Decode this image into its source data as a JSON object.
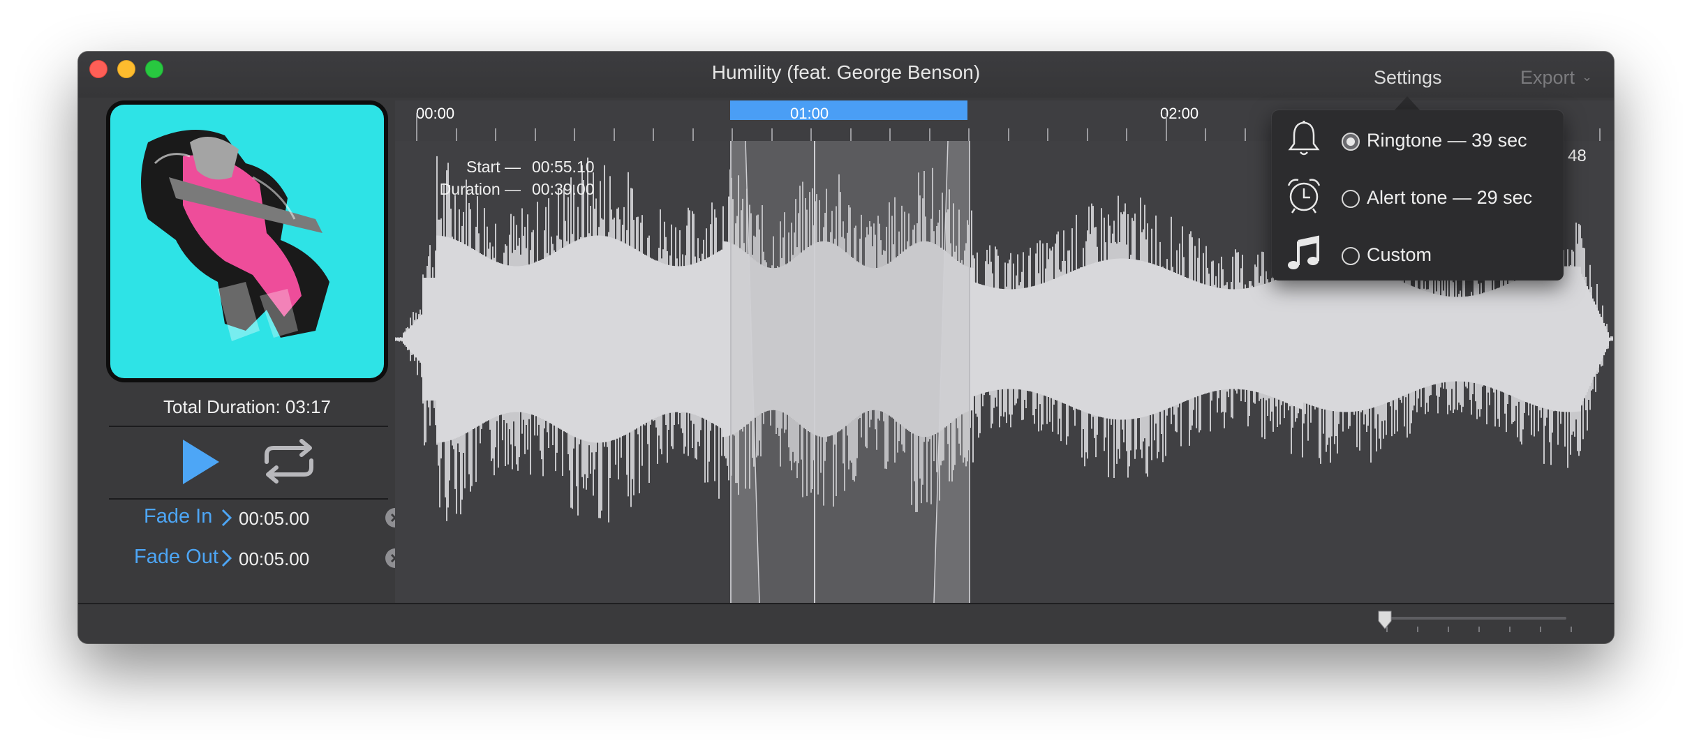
{
  "window": {
    "title": "Humility (feat. George Benson)",
    "settings_label": "Settings",
    "export_label": "Export"
  },
  "left_panel": {
    "total_duration": "Total Duration: 03:17",
    "fade_in": {
      "label": "Fade In",
      "value": "00:05.00"
    },
    "fade_out": {
      "label": "Fade Out",
      "value": "00:05.00"
    }
  },
  "timeline": {
    "ticks": [
      "00:00",
      "01:00",
      "02:00"
    ],
    "end_time_partial": "48",
    "selection": {
      "start_label": "Start —",
      "start_value": "00:55.10",
      "duration_label": "Duration —",
      "duration_value": "00:39.00"
    }
  },
  "settings_popover": {
    "options": [
      {
        "label": "Ringtone — 39 sec",
        "selected": true,
        "icon": "bell-icon"
      },
      {
        "label": "Alert tone — 29 sec",
        "selected": false,
        "icon": "alarm-clock-icon"
      },
      {
        "label": "Custom",
        "selected": false,
        "icon": "music-note-icon"
      }
    ]
  },
  "colors": {
    "accent": "#4a9ef5",
    "window_bg": "#3a3a3c",
    "waveform": "#c8c8cb"
  }
}
